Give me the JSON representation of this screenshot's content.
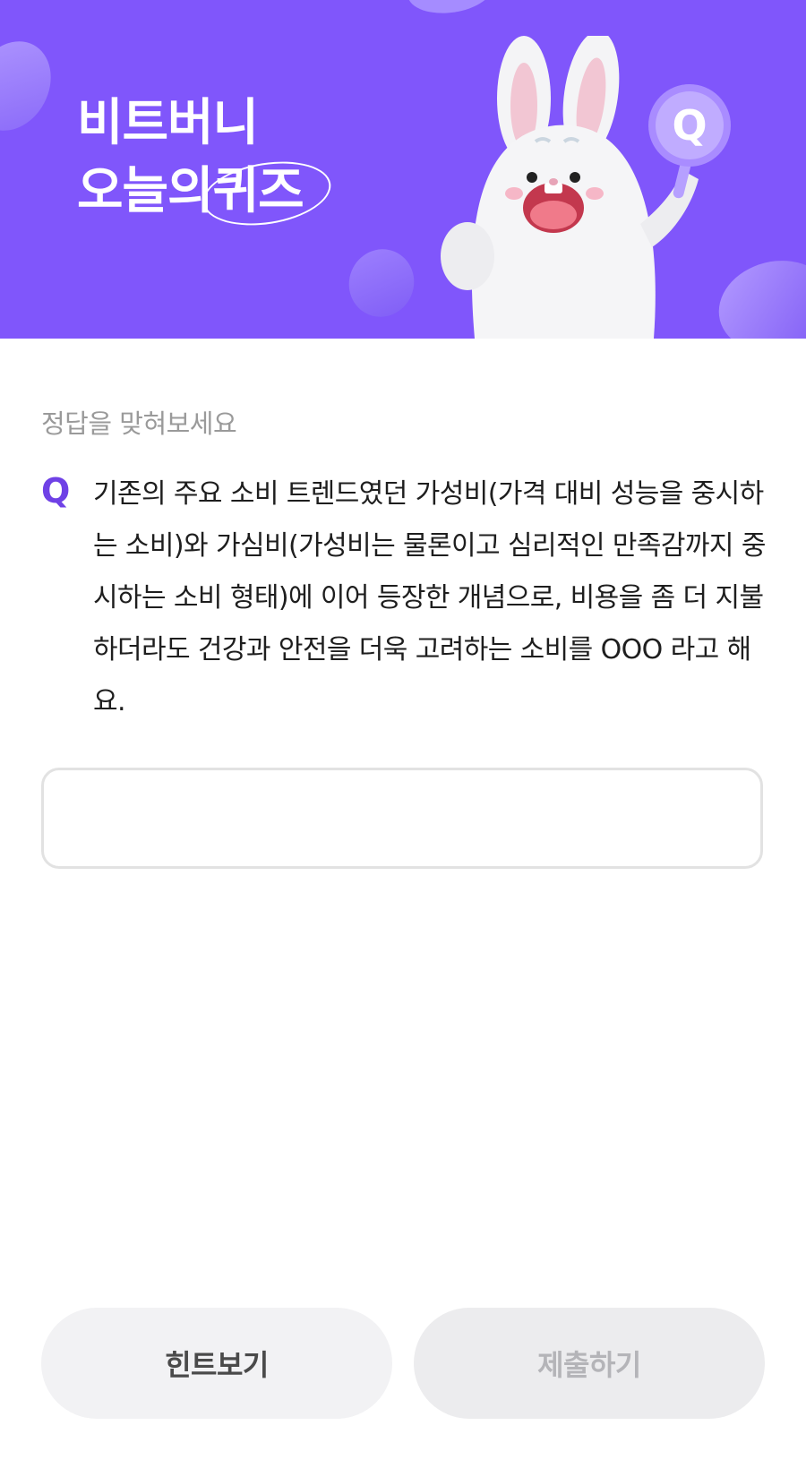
{
  "banner": {
    "title_line1": "비트버니",
    "title_line2_prefix": "오늘의",
    "title_line2_highlight": "퀴즈",
    "mascot_sign": "Q",
    "background_color": "#8056fb"
  },
  "quiz": {
    "instruction": "정답을 맞혀보세요",
    "q_label": "Q",
    "question": "기존의 주요 소비 트렌드였던 가성비(가격 대비 성능을 중시하는 소비)와 가심비(가성비는 물론이고 심리적인 만족감까지 중시하는 소비 형태)에 이어 등장한 개념으로, 비용을 좀 더 지불하더라도 건강과 안전을 더욱 고려하는 소비를 OOO 라고 해요.",
    "answer_value": "",
    "accent_color": "#6f41e6"
  },
  "buttons": {
    "hint_label": "힌트보기",
    "submit_label": "제출하기"
  }
}
